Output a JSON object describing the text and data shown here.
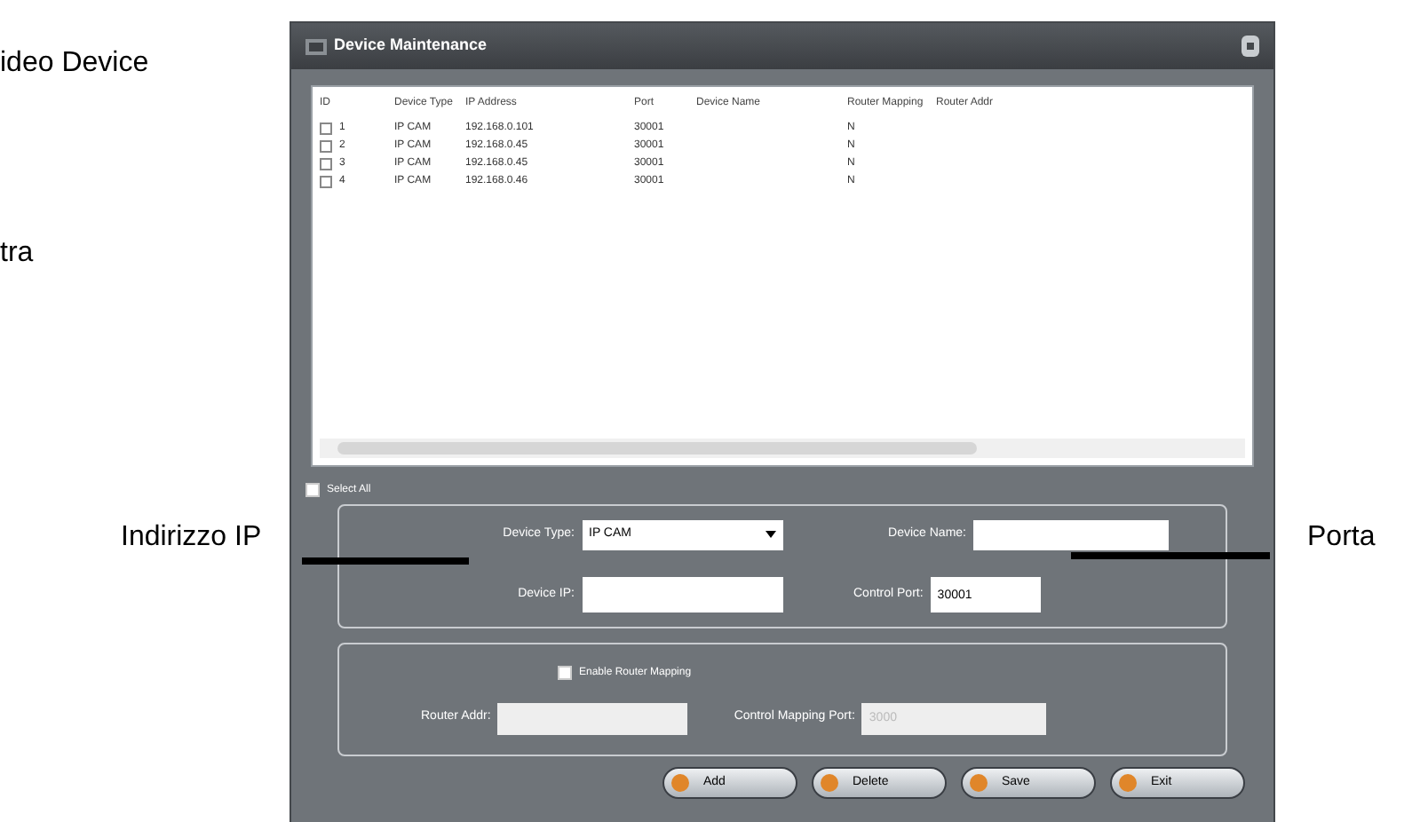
{
  "annotations": [
    {
      "text": "ideo Device"
    },
    {
      "text": "tra"
    },
    {
      "text": "Indirizzo IP"
    },
    {
      "text": "Porta"
    }
  ],
  "window": {
    "title": "Device Maintenance"
  },
  "table": {
    "columns": [
      "ID",
      "Device Type",
      "IP Address",
      "Port",
      "Device Name",
      "Router Mapping",
      "Router Addr"
    ],
    "rows": [
      {
        "checked": false,
        "cells": [
          "1",
          "IP CAM",
          "192.168.0.101",
          "30001",
          "",
          "N",
          ""
        ]
      },
      {
        "checked": false,
        "cells": [
          "2",
          "IP CAM",
          "192.168.0.45",
          "30001",
          "",
          "N",
          ""
        ]
      },
      {
        "checked": false,
        "cells": [
          "3",
          "IP CAM",
          "192.168.0.45",
          "30001",
          "",
          "N",
          ""
        ]
      },
      {
        "checked": false,
        "cells": [
          "4",
          "IP CAM",
          "192.168.0.46",
          "30001",
          "",
          "N",
          ""
        ]
      }
    ]
  },
  "select_all": {
    "label": "Select All",
    "checked": false
  },
  "device": {
    "type_label": "Device Type:",
    "type_value": "IP CAM",
    "name_label": "Device Name:",
    "ip_label": "Device IP:",
    "port_label": "Control Port:",
    "port_value": "30001"
  },
  "router": {
    "enable_label": "Enable Router Mapping",
    "enabled": false,
    "addr_label": "Router Addr:",
    "mapping_port_label": "Control Mapping Port:",
    "mapping_port_value": "3000"
  },
  "buttons": [
    "Add",
    "Delete",
    "Save",
    "Exit"
  ]
}
